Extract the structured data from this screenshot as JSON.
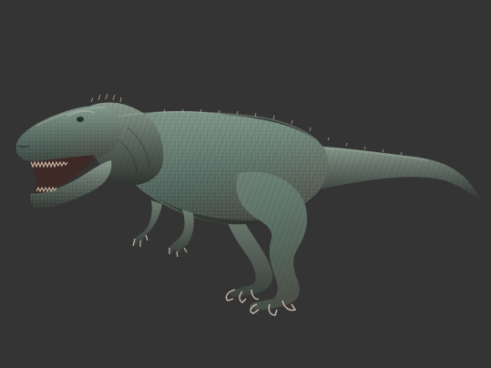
{
  "scene": {
    "subject": "theropod-dinosaur-3d-sculpt",
    "background_color": "#343434",
    "colors": {
      "skin_base": "#5d6a62",
      "skin_light": "#8a9a8c",
      "skin_dark": "#2f3531",
      "teal_tint": "#5f8c80",
      "copper_tint": "#8a6a55",
      "mouth_interior": "#3d2a26",
      "teeth": "#c9b9a4",
      "claws": "#c7b7a6"
    }
  }
}
